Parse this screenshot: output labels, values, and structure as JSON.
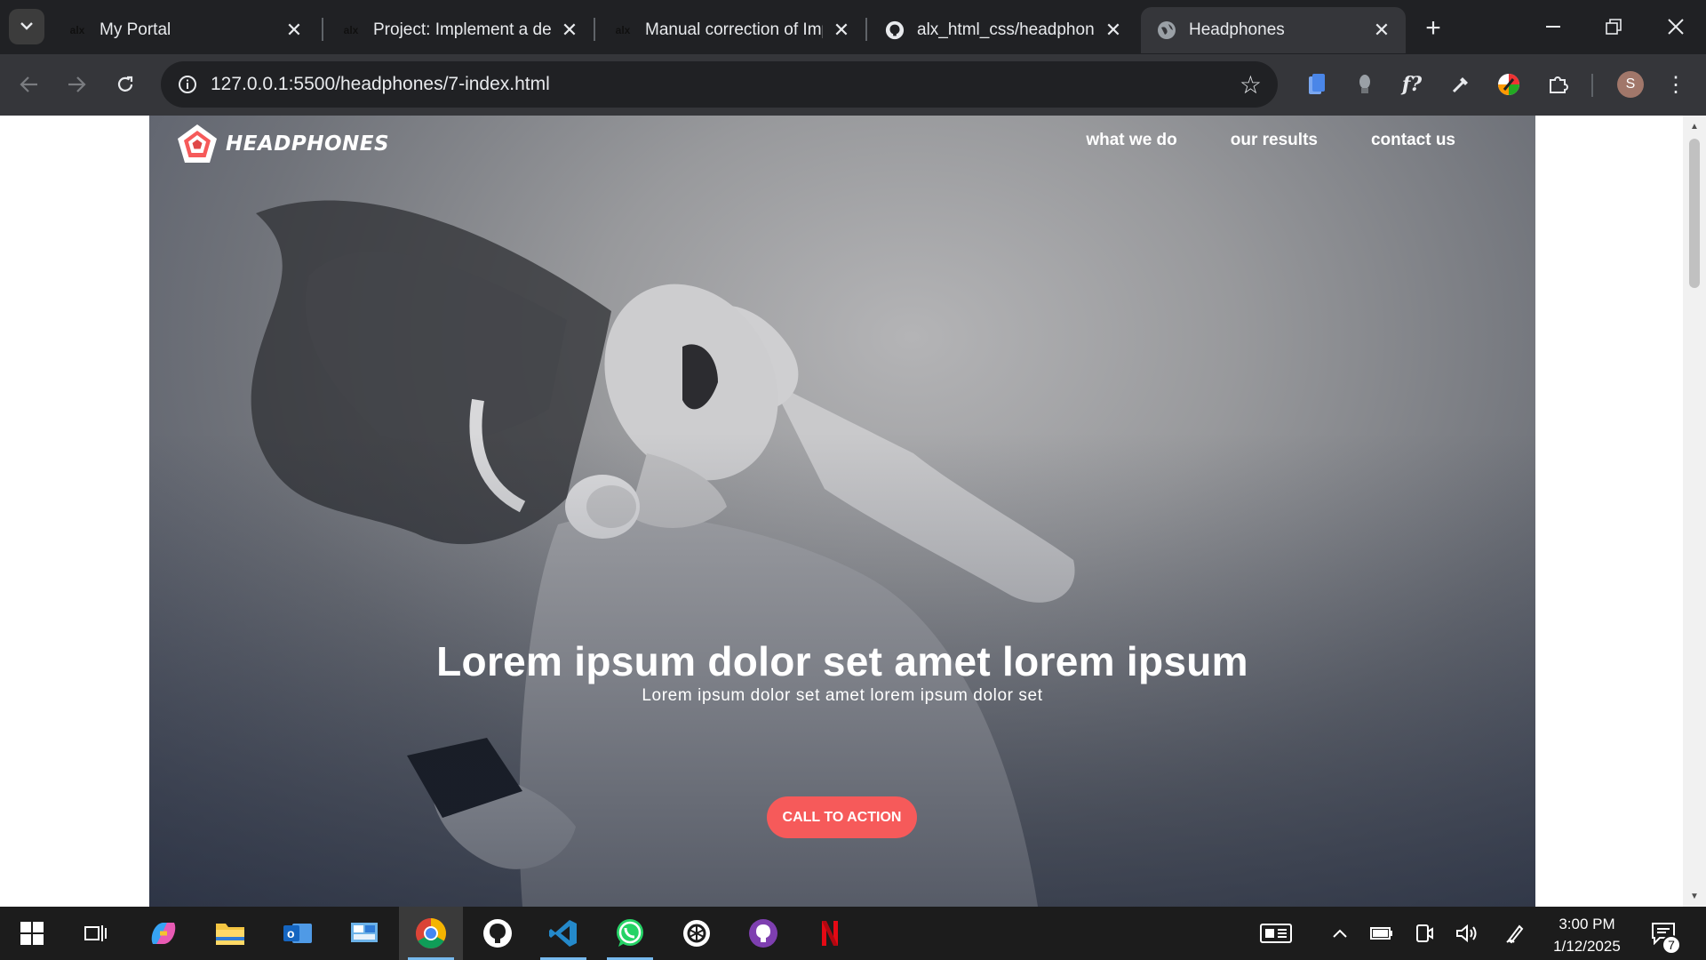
{
  "browser": {
    "tabs": [
      {
        "title": "My Portal",
        "favicon": "alx"
      },
      {
        "title": "Project: Implement a des",
        "favicon": "alx"
      },
      {
        "title": "Manual correction of Imp",
        "favicon": "alx"
      },
      {
        "title": "alx_html_css/headphone",
        "favicon": "github"
      },
      {
        "title": "Headphones",
        "favicon": "globe",
        "active": true
      }
    ],
    "url": "127.0.0.1:5500/headphones/7-index.html",
    "profile_initial": "S"
  },
  "page": {
    "logo_text": "HEADPHONES",
    "nav": [
      "what we do",
      "our results",
      "contact us"
    ],
    "hero_title": "Lorem ipsum dolor set amet lorem ipsum",
    "hero_subtitle": "Lorem ipsum dolor set amet lorem ipsum dolor set",
    "cta_label": "CALL TO ACTION",
    "cta_color": "#f65a5a"
  },
  "taskbar": {
    "time": "3:00 PM",
    "date": "1/12/2025",
    "notification_count": "7"
  }
}
